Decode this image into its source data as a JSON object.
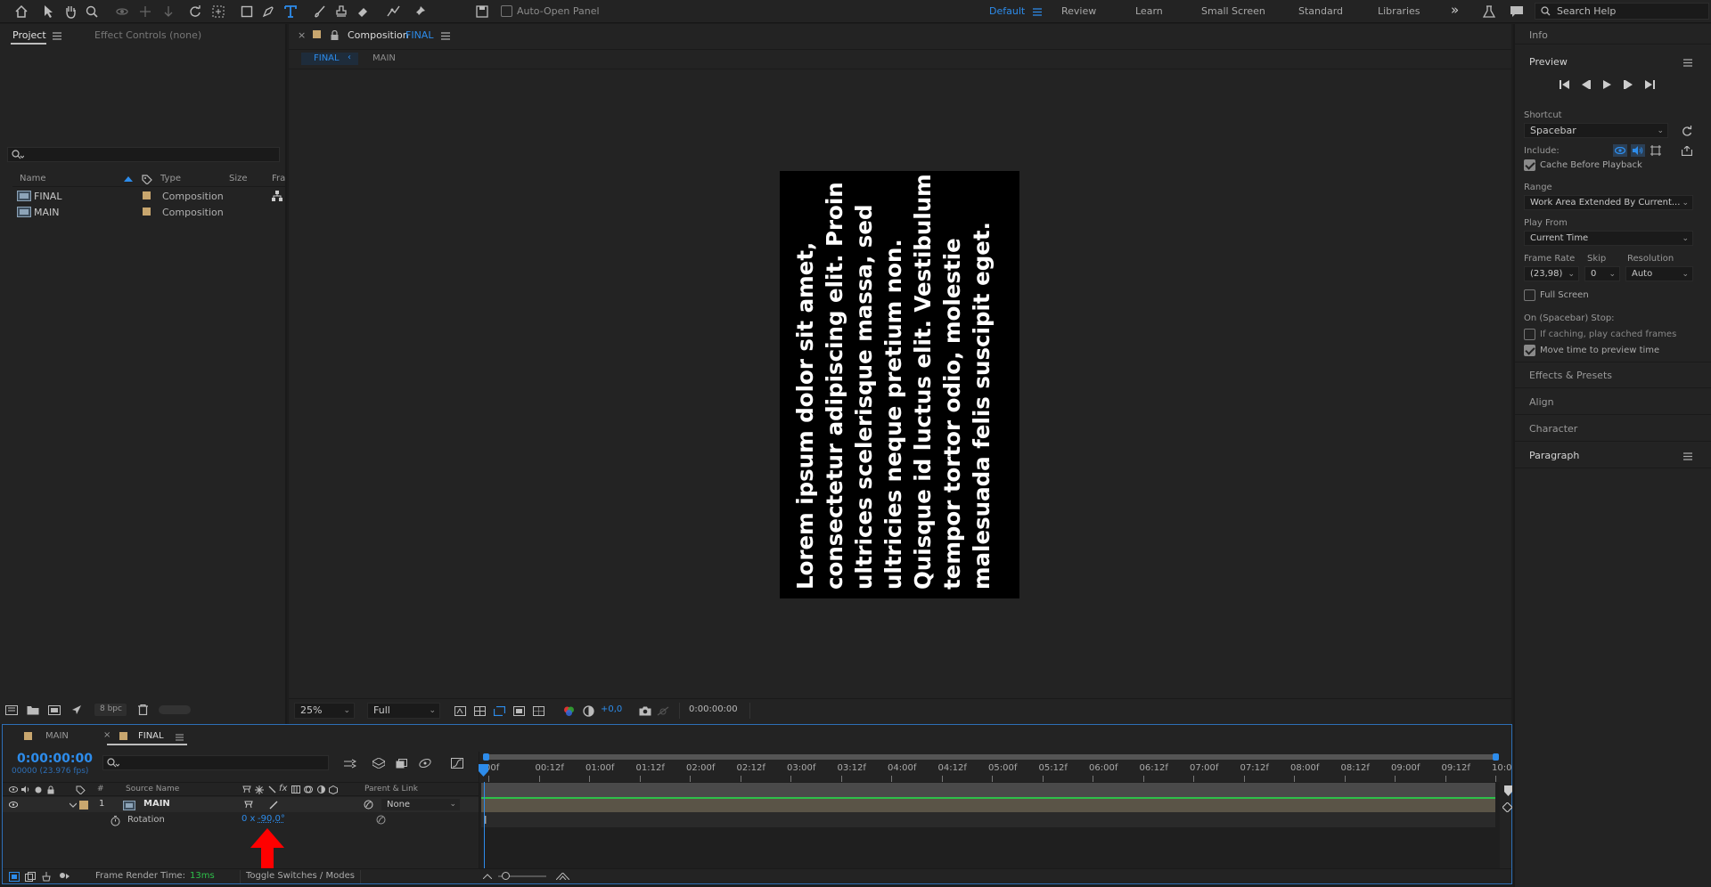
{
  "topbar": {
    "auto_open_panel": "Auto-Open Panel",
    "workspaces": [
      "Default",
      "Review",
      "Learn",
      "Small Screen",
      "Standard",
      "Libraries"
    ],
    "overflow": "»",
    "search_placeholder": "Search Help"
  },
  "project": {
    "tab_project": "Project",
    "tab_effect_controls": "Effect Controls (none)",
    "columns": {
      "name": "Name",
      "type": "Type",
      "size": "Size",
      "frame": "Fra"
    },
    "items": [
      {
        "name": "FINAL",
        "type": "Composition"
      },
      {
        "name": "MAIN",
        "type": "Composition"
      }
    ],
    "bpc": "8 bpc"
  },
  "composition": {
    "tab_prefix": "Composition",
    "tab_name": "FINAL",
    "breadcrumb_final": "FINAL",
    "breadcrumb_main": "MAIN",
    "lines": [
      "Lorem ipsum dolor sit amet,",
      "consectetur adipiscing elit. Proin",
      "ultrices scelerisque massa, sed",
      "ultricies neque pretium non.",
      "Quisque id luctus elit. Vestibulum",
      "tempor tortor odio, molestie",
      "malesuada felis suscipit eget."
    ],
    "zoom": "25%",
    "resolution": "Full",
    "exposure": "+0,0",
    "timecode": "0:00:00:00"
  },
  "right_panel": {
    "info": "Info",
    "preview": "Preview",
    "shortcut_label": "Shortcut",
    "shortcut_value": "Spacebar",
    "include_label": "Include:",
    "cache_before_playback": "Cache Before Playback",
    "range_label": "Range",
    "range_value": "Work Area Extended By Current...",
    "play_from_label": "Play From",
    "play_from_value": "Current Time",
    "frame_rate_label": "Frame Rate",
    "skip_label": "Skip",
    "resolution_label": "Resolution",
    "frame_rate_value": "(23,98)",
    "skip_value": "0",
    "resolution_value": "Auto",
    "full_screen": "Full Screen",
    "on_stop_label": "On (Spacebar) Stop:",
    "if_caching": "If caching, play cached frames",
    "move_time": "Move time to preview time",
    "sections": [
      "Effects & Presets",
      "Align",
      "Character",
      "Paragraph"
    ]
  },
  "timeline": {
    "tab_main": "MAIN",
    "tab_final": "FINAL",
    "current_time": "0:00:00:00",
    "frame_info": "00000 (23.976 fps)",
    "columns": {
      "number": "#",
      "source_name": "Source Name",
      "parent": "Parent & Link"
    },
    "layer": {
      "number": "1",
      "name": "MAIN",
      "parent": "None"
    },
    "property": {
      "name": "Rotation",
      "value_rev": "0 x",
      "value_deg": "-90,0°"
    },
    "ruler": [
      "00f",
      "00:12f",
      "01:00f",
      "01:12f",
      "02:00f",
      "02:12f",
      "03:00f",
      "03:12f",
      "04:00f",
      "04:12f",
      "05:00f",
      "05:12f",
      "06:00f",
      "06:12f",
      "07:00f",
      "07:12f",
      "08:00f",
      "08:12f",
      "09:00f",
      "09:12f",
      "10:0"
    ],
    "frame_render_label": "Frame Render Time:",
    "frame_render_value": "13ms",
    "toggle_modes": "Toggle Switches / Modes"
  },
  "colors": {
    "accent": "#2d8ceb",
    "annotation_arrow": "#ff0000",
    "layer_bar": "#5a5447",
    "label_tan": "#c8a66e"
  }
}
